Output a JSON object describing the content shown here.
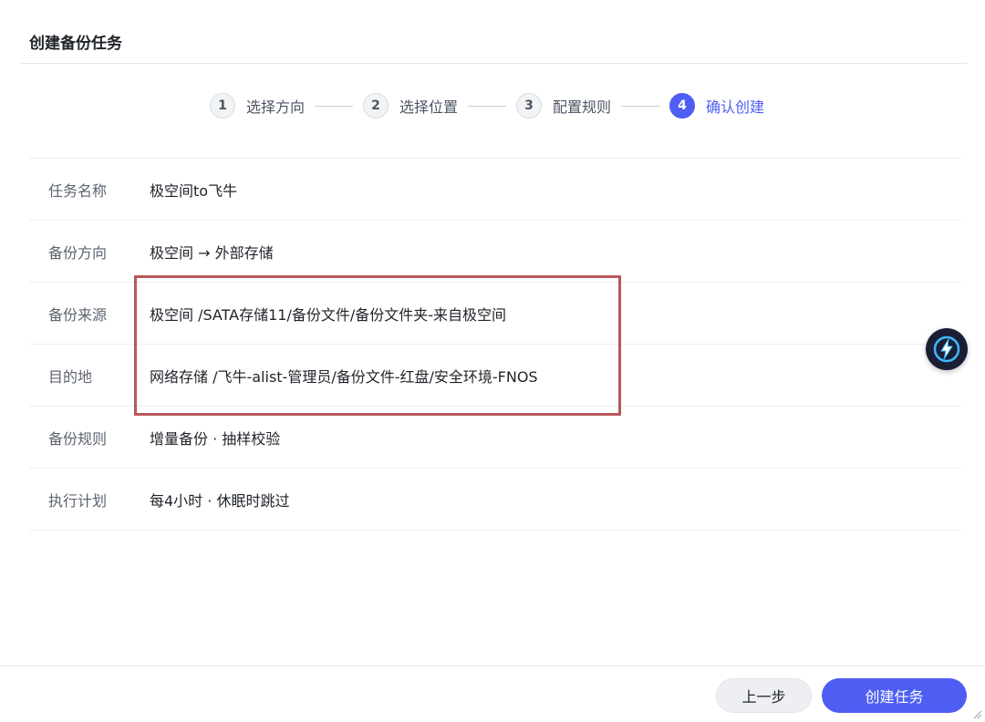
{
  "dialog": {
    "title": "创建备份任务"
  },
  "steps": [
    {
      "num": "1",
      "label": "选择方向",
      "active": false
    },
    {
      "num": "2",
      "label": "选择位置",
      "active": false
    },
    {
      "num": "3",
      "label": "配置规则",
      "active": false
    },
    {
      "num": "4",
      "label": "确认创建",
      "active": true
    }
  ],
  "summary": {
    "rows": [
      {
        "key": "任务名称",
        "value": "极空间to飞牛"
      },
      {
        "key": "备份方向",
        "value": "极空间 → 外部存储"
      },
      {
        "key": "备份来源",
        "value": "极空间 /SATA存储11/备份文件/备份文件夹-来自极空间"
      },
      {
        "key": "目的地",
        "value": "网络存储 /飞牛-alist-管理员/备份文件-红盘/安全环境-FNOS"
      },
      {
        "key": "备份规则",
        "value": "增量备份 · 抽样校验"
      },
      {
        "key": "执行计划",
        "value": "每4小时 · 休眠时跳过"
      }
    ]
  },
  "footer": {
    "prev_label": "上一步",
    "create_label": "创建任务"
  },
  "colors": {
    "accent": "#4f5ef2",
    "highlight_border": "#b9575a"
  },
  "icons": {
    "floating": "lightning-assistant-icon"
  }
}
